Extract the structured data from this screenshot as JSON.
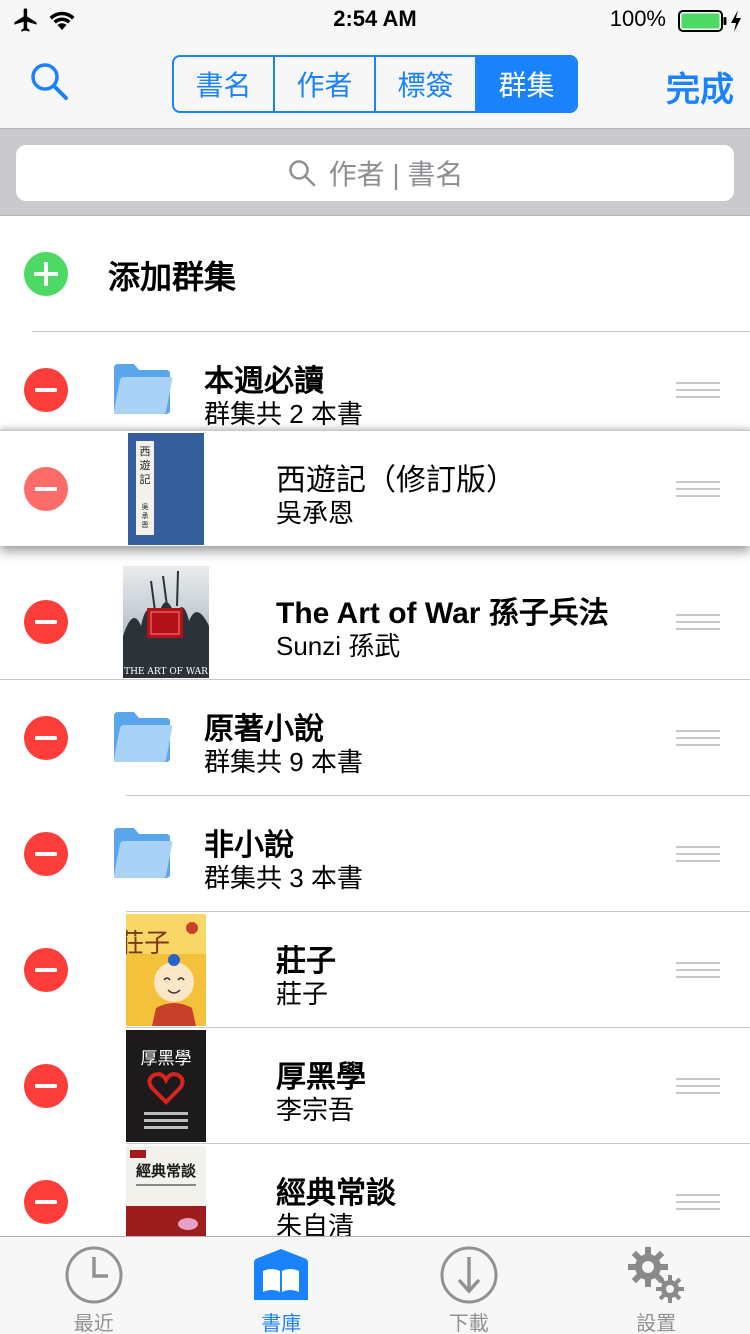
{
  "status_bar": {
    "time": "2:54 AM",
    "battery_percent": "100%",
    "battery_level": 1.0,
    "battery_color": "#4cd964"
  },
  "nav": {
    "search_icon": "search-icon",
    "segments": [
      {
        "label": "書名",
        "active": false
      },
      {
        "label": "作者",
        "active": false
      },
      {
        "label": "標簽",
        "active": false
      },
      {
        "label": "群集",
        "active": true
      }
    ],
    "done_label": "完成",
    "accent_color": "#1a82fb"
  },
  "search": {
    "placeholder": "作者 | 書名"
  },
  "list": {
    "add_label": "添加群集",
    "items": [
      {
        "type": "collection",
        "title": "本週必讀",
        "subtitle": "群集共 2 本書"
      },
      {
        "type": "book",
        "title": "西遊記（修訂版）",
        "subtitle": "吳承恩",
        "cover_text": "西遊記",
        "cover_author": "吳承恩",
        "dragging": true
      },
      {
        "type": "book",
        "title": "The Art of War 孫子兵法",
        "subtitle": "Sunzi 孫武",
        "cover_text": "THE ART OF WAR"
      },
      {
        "type": "collection",
        "title": "原著小說",
        "subtitle": "群集共 9 本書"
      },
      {
        "type": "collection",
        "title": "非小說",
        "subtitle": "群集共 3 本書"
      },
      {
        "type": "book",
        "title": "莊子",
        "subtitle": "莊子",
        "cover_text": "莊子"
      },
      {
        "type": "book",
        "title": "厚黑學",
        "subtitle": "李宗吾",
        "cover_text": "厚黑學"
      },
      {
        "type": "book",
        "title": "經典常談",
        "subtitle": "朱自清",
        "cover_text": "經典常談"
      }
    ]
  },
  "tab_bar": {
    "tabs": [
      {
        "label": "最近",
        "icon": "clock-icon",
        "active": false
      },
      {
        "label": "書庫",
        "icon": "library-icon",
        "active": true
      },
      {
        "label": "下載",
        "icon": "download-icon",
        "active": false
      },
      {
        "label": "設置",
        "icon": "gear-icon",
        "active": false
      }
    ]
  }
}
